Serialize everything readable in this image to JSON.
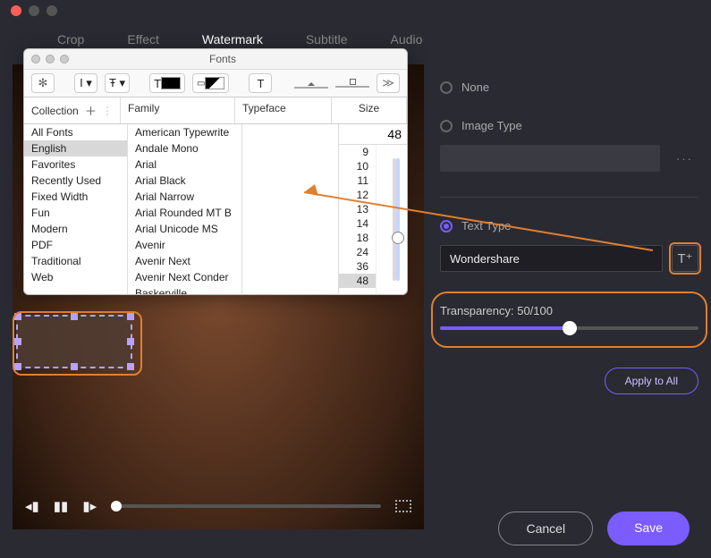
{
  "tabs": [
    "Crop",
    "Effect",
    "Watermark",
    "Subtitle",
    "Audio"
  ],
  "active_tab": "Watermark",
  "side": {
    "none_label": "None",
    "image_type_label": "Image Type",
    "image_more": "···",
    "text_type_label": "Text Type",
    "text_value": "Wondershare",
    "transparency_label": "Transparency: 50/100",
    "transparency_value": 50,
    "apply_label": "Apply to All"
  },
  "footer": {
    "cancel": "Cancel",
    "save": "Save"
  },
  "fonts_popup": {
    "title": "Fonts",
    "headers": {
      "collection": "Collection",
      "family": "Family",
      "typeface": "Typeface",
      "size": "Size"
    },
    "collections": [
      "All Fonts",
      "English",
      "Favorites",
      "Recently Used",
      "Fixed Width",
      "Fun",
      "Modern",
      "PDF",
      "Traditional",
      "Web"
    ],
    "collections_selected": "English",
    "families": [
      "American Typewrite",
      "Andale Mono",
      "Arial",
      "Arial Black",
      "Arial Narrow",
      "Arial Rounded MT B",
      "Arial Unicode MS",
      "Avenir",
      "Avenir Next",
      "Avenir Next Conder",
      "Baskerville"
    ],
    "sizes": [
      9,
      10,
      11,
      12,
      13,
      14,
      18,
      24,
      36,
      48
    ],
    "size_selected": 48,
    "size_value": "48"
  }
}
